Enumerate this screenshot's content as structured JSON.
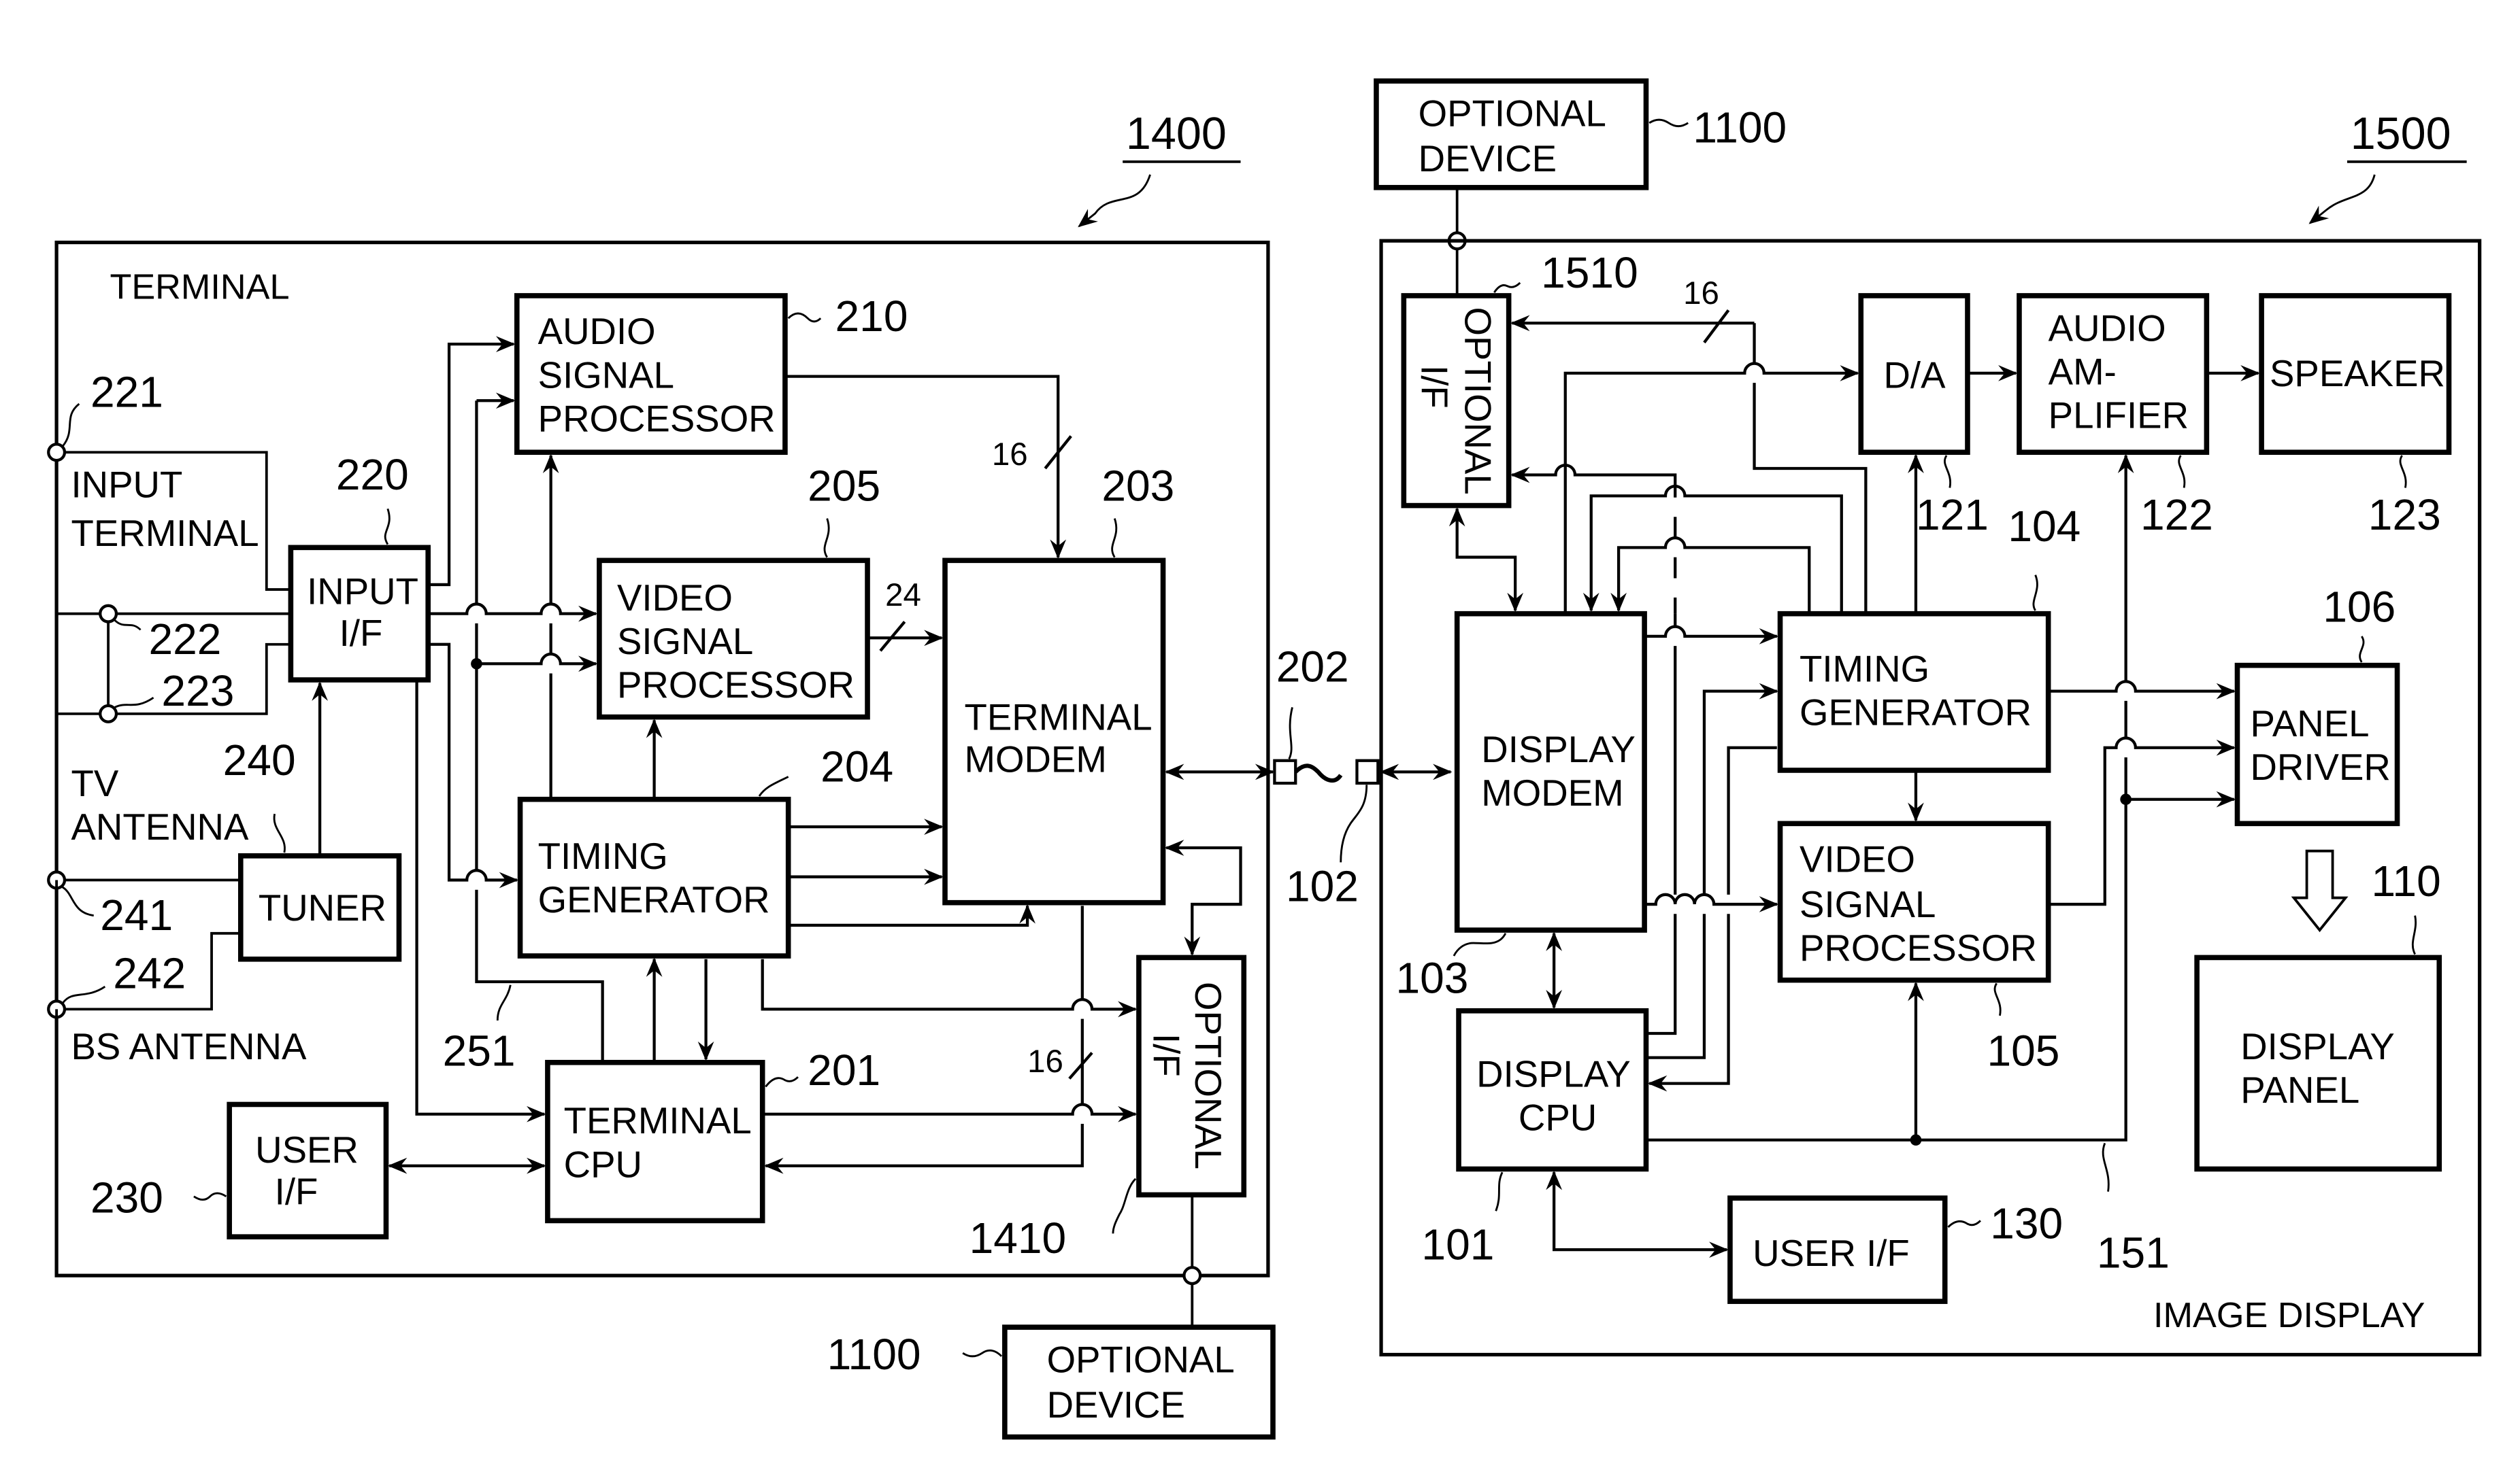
{
  "figure": {
    "terminal_ref": "1400",
    "display_ref": "1500",
    "terminal_frame_label": "TERMINAL",
    "display_frame_label": "IMAGE  DISPLAY"
  },
  "terminal": {
    "audio_proc": {
      "ref": "210",
      "lines": [
        "AUDIO",
        "SIGNAL",
        "PROCESSOR"
      ]
    },
    "video_proc": {
      "ref": "205",
      "lines": [
        "VIDEO",
        "SIGNAL",
        "PROCESSOR"
      ]
    },
    "modem": {
      "ref": "203",
      "lines": [
        "TERMINAL",
        "MODEM"
      ]
    },
    "input_if": {
      "ref": "220",
      "lines": [
        "INPUT",
        "I/F"
      ]
    },
    "timing_gen": {
      "ref": "204",
      "lines": [
        "TIMING",
        "GENERATOR"
      ]
    },
    "tuner": {
      "ref": "240",
      "lines": [
        "TUNER"
      ]
    },
    "cpu": {
      "ref": "201",
      "lines": [
        "TERMINAL",
        "CPU"
      ]
    },
    "user_if": {
      "ref": "230",
      "lines": [
        "USER",
        "I/F"
      ]
    },
    "optional_if": {
      "ref": "1410",
      "lines": [
        "OPTIONAL",
        "I/F"
      ]
    },
    "input_terminal": {
      "label_lines": [
        "INPUT",
        "TERMINAL"
      ],
      "refs": [
        "221",
        "222",
        "223"
      ]
    },
    "tv_antenna": {
      "label_lines": [
        "TV",
        "ANTENNA"
      ],
      "ref": "241"
    },
    "bs_antenna": {
      "label": "BS  ANTENNA",
      "ref": "242"
    },
    "bus_ref": "251",
    "bus_widths": {
      "audio": "16",
      "video": "24",
      "optional": "16"
    },
    "connector_ref": "202"
  },
  "display": {
    "optional_if": {
      "ref": "1510",
      "lines": [
        "OPTIONAL",
        "I/F"
      ]
    },
    "da": {
      "ref": "121",
      "lines": [
        "D/A"
      ]
    },
    "audio_amp": {
      "ref": "122",
      "lines": [
        "AUDIO",
        "AM-",
        "PLIFIER"
      ]
    },
    "speaker": {
      "ref": "123",
      "lines": [
        "SPEAKER"
      ]
    },
    "modem": {
      "ref": "103",
      "lines": [
        "DISPLAY",
        "MODEM"
      ]
    },
    "timing_gen": {
      "ref": "104",
      "lines": [
        "TIMING",
        "GENERATOR"
      ]
    },
    "video_proc": {
      "ref": "105",
      "lines": [
        "VIDEO",
        "SIGNAL",
        "PROCESSOR"
      ]
    },
    "panel_driver": {
      "ref": "106",
      "lines": [
        "PANEL",
        "DRIVER"
      ]
    },
    "display_panel": {
      "ref": "110",
      "lines": [
        "DISPLAY",
        "PANEL"
      ]
    },
    "cpu": {
      "ref": "101",
      "lines": [
        "DISPLAY",
        "CPU"
      ]
    },
    "user_if": {
      "ref": "130",
      "lines": [
        "USER  I/F"
      ]
    },
    "bus_ref": "151",
    "bus_width": "16",
    "connector_ref": "102"
  },
  "optional_device_top": {
    "ref": "1100",
    "lines": [
      "OPTIONAL",
      "DEVICE"
    ]
  },
  "optional_device_bottom": {
    "ref": "1100",
    "lines": [
      "OPTIONAL",
      "DEVICE"
    ]
  }
}
